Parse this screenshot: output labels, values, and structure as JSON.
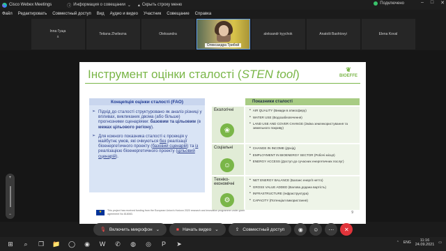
{
  "titlebar": {
    "app_name": "Cisco Webex Meetings",
    "meeting_info": "Информация о совещании",
    "hide_bar": "Скрыть строку меню",
    "connection": "Подключено",
    "accent": "#39c36b"
  },
  "menu": [
    "Файл",
    "Редактировать",
    "Совместный доступ",
    "Вид",
    "Аудио и видео",
    "Участник",
    "Совещание",
    "Справка"
  ],
  "participants": [
    {
      "name": "Inna Гуща",
      "sub": "a"
    },
    {
      "name": "Tetiana Zheliezna",
      "sub": ""
    },
    {
      "name": "Oleksandra",
      "sub": ""
    },
    {
      "name": "Олександра Трибой",
      "sub": "",
      "video": true
    },
    {
      "name": "aleksandr kyychok",
      "sub": ""
    },
    {
      "name": "Anatolii Bashtovyi",
      "sub": ""
    },
    {
      "name": "Elena Koval",
      "sub": ""
    }
  ],
  "slide": {
    "title_main": "Інструмент оцінки сталості (",
    "title_italic": "STEN tool",
    "title_end": ")",
    "brand": "BIOEFFE",
    "concept_heading": "Концепція оцінки сталості (FAO)",
    "bullet1_a": "Підхід до сталості структуровано як аналіз різниці у впливах, викликаних двома (або більше) прогнозними сценаріями: ",
    "bullet1_b": "базовим та цільовим",
    "bullet1_c": " (в ",
    "bullet1_d": "межах цільового регіону",
    "bullet1_e": ").",
    "bullet2_a": "Для кожного показника сталості є проекція у майбутнє умов, які очікуються ",
    "bullet2_b": "без",
    "bullet2_c": " реалізації біоенергетичного проекту (",
    "bullet2_d": "базовий сценарій",
    "bullet2_e": ") та ",
    "bullet2_f": "із",
    "bullet2_g": " реалізацією біоенергетичного проекту (",
    "bullet2_h": "цільовий сценарій",
    "bullet2_i": ").",
    "table_header": "Показники сталості",
    "rows": [
      {
        "category": "Екологічні",
        "items": [
          "AIR QUALITY (Викиди в атмосферу)",
          "WATER USE (Водозабезпечення)",
          "LAND USE AND COVER CHANGE (Зміна землекористування та земельного покриву)"
        ]
      },
      {
        "category": "Соціальні",
        "items": [
          "CHANGE IN INCOME (Дохід)",
          "EMPLOYMENT IN BIOENERGY SECTOR (Робочі місця)",
          "ENERGY ACCESS (Доступ до сучасних енергетичних послуг)"
        ]
      },
      {
        "category": "Техніко-економічні",
        "items": [
          "NET ENERGY BALANCE (Баланс енергії нетто)",
          "GROSS VALUE ADDED (Валова додана вартість)",
          "INFRASTRUCTURE (Інфраструктура)",
          "CAPACITY (Потенціал використання)"
        ]
      }
    ],
    "footer": "This project has received funding from the European Union's Horizon 2020 research and innovation programme under grant agreement No 818083.",
    "page": "9",
    "accent": "#7ab648"
  },
  "controls": {
    "mic": "Включить микрофон",
    "video": "Начать видео",
    "share": "Совместный доступ"
  },
  "taskbar": {
    "lang": "ENG",
    "time": "11:16",
    "date": "24.09.2021"
  }
}
